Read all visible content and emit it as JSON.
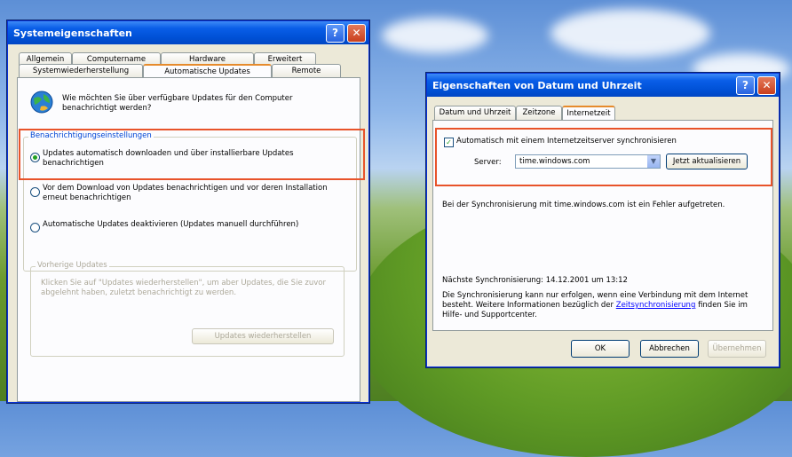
{
  "left_window": {
    "title": "Systemeigenschaften",
    "tabs_row1": [
      "Allgemein",
      "Computername",
      "Hardware",
      "Erweitert"
    ],
    "tabs_row2": [
      "Systemwiederherstellung",
      "Automatische Updates",
      "Remote"
    ],
    "active_tab": "Automatische Updates",
    "question": "Wie möchten Sie über verfügbare Updates für den Computer benachrichtigt werden?",
    "group_notify_title": "Benachrichtigungseinstellungen",
    "radio1": "Updates automatisch downloaden und über installierbare Updates benachrichtigen",
    "radio2": "Vor dem Download von Updates benachrichtigen und vor deren Installation erneut benachrichtigen",
    "radio3": "Automatische Updates deaktivieren (Updates manuell durchführen)",
    "group_prev_title": "Vorherige Updates",
    "prev_text": "Klicken Sie auf \"Updates wiederherstellen\", um aber Updates, die Sie zuvor abgelehnt haben, zuletzt benachrichtigt zu werden.",
    "restore_button": "Updates wiederherstellen"
  },
  "right_window": {
    "title": "Eigenschaften von Datum und Uhrzeit",
    "tabs": [
      "Datum und Uhrzeit",
      "Zeitzone",
      "Internetzeit"
    ],
    "active_tab": "Internetzeit",
    "sync_checkbox": "Automatisch mit einem Internetzeitserver synchronisieren",
    "server_label": "Server:",
    "server_value": "time.windows.com",
    "update_now_button": "Jetzt aktualisieren",
    "error_text": "Bei der Synchronisierung mit time.windows.com ist ein Fehler aufgetreten.",
    "next_sync": "Nächste Synchronisierung: 14.12.2001 um 13:12",
    "info_text_1": "Die Synchronisierung kann nur erfolgen, wenn eine Verbindung mit dem Internet besteht. Weitere Informationen bezüglich der",
    "info_link": "Zeitsynchronisierung",
    "info_text_2": "finden Sie im Hilfe- und Supportcenter.",
    "ok_button": "OK",
    "cancel_button": "Abbrechen",
    "apply_button": "Übernehmen"
  },
  "colors": {
    "highlight": "#e8532a",
    "titlebar": "#0a5ee8",
    "window_bg": "#ece9d8"
  }
}
